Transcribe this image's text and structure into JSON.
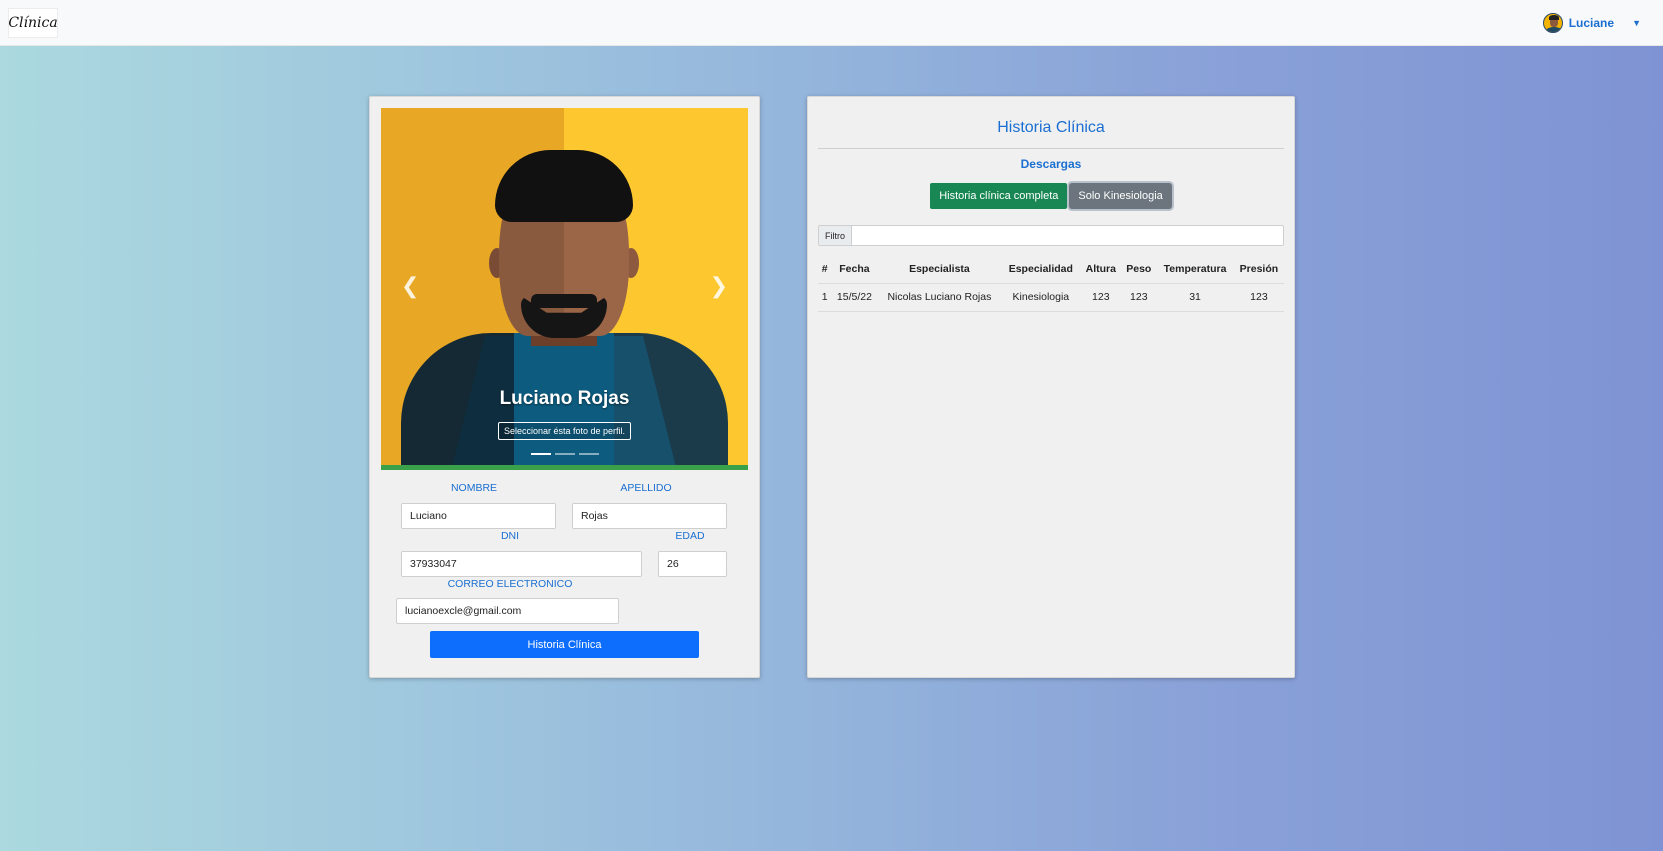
{
  "nav": {
    "logo_text": "Clínica",
    "user_name": "Luciane"
  },
  "profile": {
    "carousel": {
      "caption_title": "Luciano Rojas",
      "caption_button": "Seleccionar ésta foto de perfil.",
      "slide_count": 3,
      "active_slide": 1
    },
    "labels": {
      "nombre": "NOMBRE",
      "apellido": "APELLIDO",
      "dni": "DNI",
      "edad": "EDAD",
      "correo": "CORREO ELECTRONICO"
    },
    "values": {
      "nombre": "Luciano",
      "apellido": "Rojas",
      "dni": "37933047",
      "edad": "26",
      "correo": "lucianoexcle@gmail.com"
    },
    "history_button": "Historia Clínica"
  },
  "history": {
    "title": "Historia Clínica",
    "downloads_label": "Descargas",
    "btn_full": "Historia clínica completa",
    "btn_kine": "Solo Kinesiologia",
    "filter_label": "Filtro",
    "filter_value": "",
    "columns": [
      "#",
      "Fecha",
      "Especialista",
      "Especialidad",
      "Altura",
      "Peso",
      "Temperatura",
      "Presión"
    ],
    "rows": [
      [
        "1",
        "15/5/22",
        "Nicolas Luciano Rojas",
        "Kinesiologia",
        "123",
        "123",
        "31",
        "123"
      ]
    ]
  },
  "colors": {
    "accent": "#1a6fd1",
    "primary_button": "#0d6efd",
    "success_button": "#198754",
    "secondary_button": "#6c757d"
  }
}
